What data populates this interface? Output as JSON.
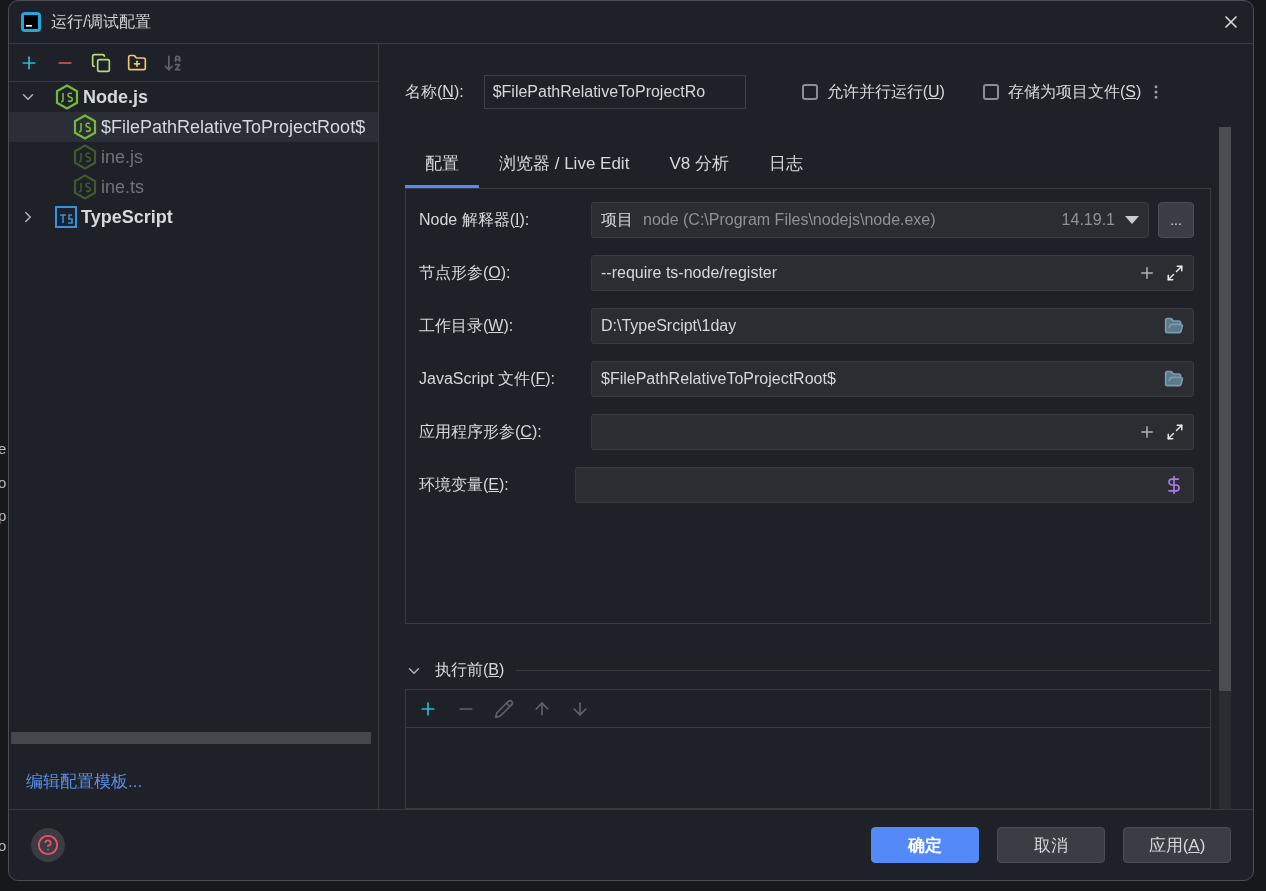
{
  "window": {
    "title": "运行/调试配置"
  },
  "background_text": [
    "e",
    "o",
    "p",
    "o"
  ],
  "toolbar": [
    {
      "kind": "add",
      "disabled": false
    },
    {
      "kind": "remove",
      "disabled": false
    },
    {
      "kind": "copy",
      "disabled": false
    },
    {
      "kind": "folder",
      "disabled": false
    },
    {
      "kind": "sort",
      "disabled": true
    }
  ],
  "tree": [
    {
      "label": "Node.js",
      "kind": "nodejs",
      "expanded": true,
      "selected": false,
      "dimmed": false,
      "children": [
        {
          "label": "$FilePathRelativeToProjectRoot$",
          "kind": "nodejs",
          "selected": true,
          "dimmed": false
        },
        {
          "label": "ine.js",
          "kind": "nodejs",
          "selected": false,
          "dimmed": true
        },
        {
          "label": "ine.ts",
          "kind": "nodejs",
          "selected": false,
          "dimmed": true
        }
      ]
    },
    {
      "label": "TypeScript",
      "kind": "typescript",
      "expanded": false,
      "selected": false,
      "dimmed": false
    }
  ],
  "edit_templates_link": "编辑配置模板...",
  "name_field": {
    "label": [
      "名称(",
      "N",
      "):"
    ],
    "value": "$FilePathRelativeToProjectRo"
  },
  "options": [
    {
      "label": [
        "允许并行运行(",
        "U",
        ")"
      ],
      "checked": false
    },
    {
      "label": [
        "存储为项目文件(",
        "S",
        ")"
      ],
      "checked": false
    }
  ],
  "tabs": [
    {
      "label": "配置",
      "selected": true
    },
    {
      "label": "浏览器 / Live Edit",
      "selected": false
    },
    {
      "label": "V8 分析",
      "selected": false
    },
    {
      "label": "日志",
      "selected": false
    }
  ],
  "fields": [
    {
      "kind": "interpreter",
      "label": [
        "Node 解释器(",
        "I",
        "):"
      ],
      "prefix": "项目",
      "value": "node (C:\\Program Files\\nodejs\\node.exe)",
      "version": "14.19.1",
      "button": "..."
    },
    {
      "kind": "expand",
      "label": [
        "节点形参(",
        "O",
        "):"
      ],
      "value": "--require ts-node/register"
    },
    {
      "kind": "folder",
      "label": [
        "工作目录(",
        "W",
        "):"
      ],
      "value": "D:\\TypeSrcipt\\1day"
    },
    {
      "kind": "folder",
      "label": [
        "JavaScript 文件(",
        "F",
        "):"
      ],
      "value": "$FilePathRelativeToProjectRoot$"
    },
    {
      "kind": "expand",
      "label": [
        "应用程序形参(",
        "C",
        "):"
      ]
    },
    {
      "kind": "env",
      "label": [
        "环境变量(",
        "E",
        "):"
      ]
    }
  ],
  "before_launch": {
    "label": [
      "执行前(",
      "B",
      ")"
    ],
    "expanded": true,
    "toolbar": [
      {
        "kind": "add",
        "disabled": false
      },
      {
        "kind": "remove",
        "disabled": true
      },
      {
        "kind": "edit",
        "disabled": true
      },
      {
        "kind": "up",
        "disabled": true
      },
      {
        "kind": "down",
        "disabled": true
      }
    ]
  },
  "buttons": [
    {
      "label": [
        "确定"
      ],
      "kind": "primary"
    },
    {
      "label": [
        "取消"
      ],
      "kind": "secondary"
    },
    {
      "label": [
        "应用(",
        "A",
        ")"
      ],
      "kind": "secondary"
    }
  ]
}
